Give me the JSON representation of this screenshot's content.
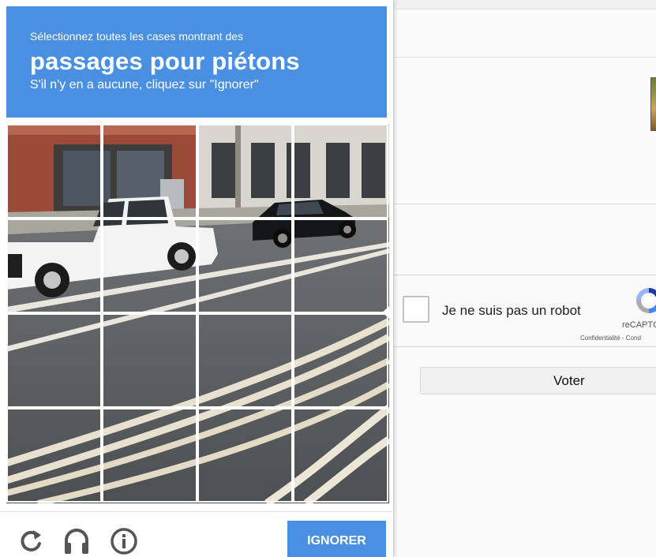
{
  "captcha": {
    "instruction": "Sélectionnez toutes les cases montrant des",
    "target": "passages pour piétons",
    "hint": "S'il n'y en a aucune, cliquez sur \"Ignorer\"",
    "grid": {
      "rows": 4,
      "cols": 4
    },
    "footer": {
      "reload_icon": "reload-icon",
      "audio_icon": "headphones-icon",
      "info_icon": "info-icon",
      "skip_label": "IGNORER"
    },
    "header_color": "#4a90e2"
  },
  "recaptcha": {
    "checkbox_label": "Je ne suis pas un robot",
    "brand": "reCAPTC",
    "links": "Confidentialité - Cond"
  },
  "page": {
    "vote_label": "Voter"
  }
}
